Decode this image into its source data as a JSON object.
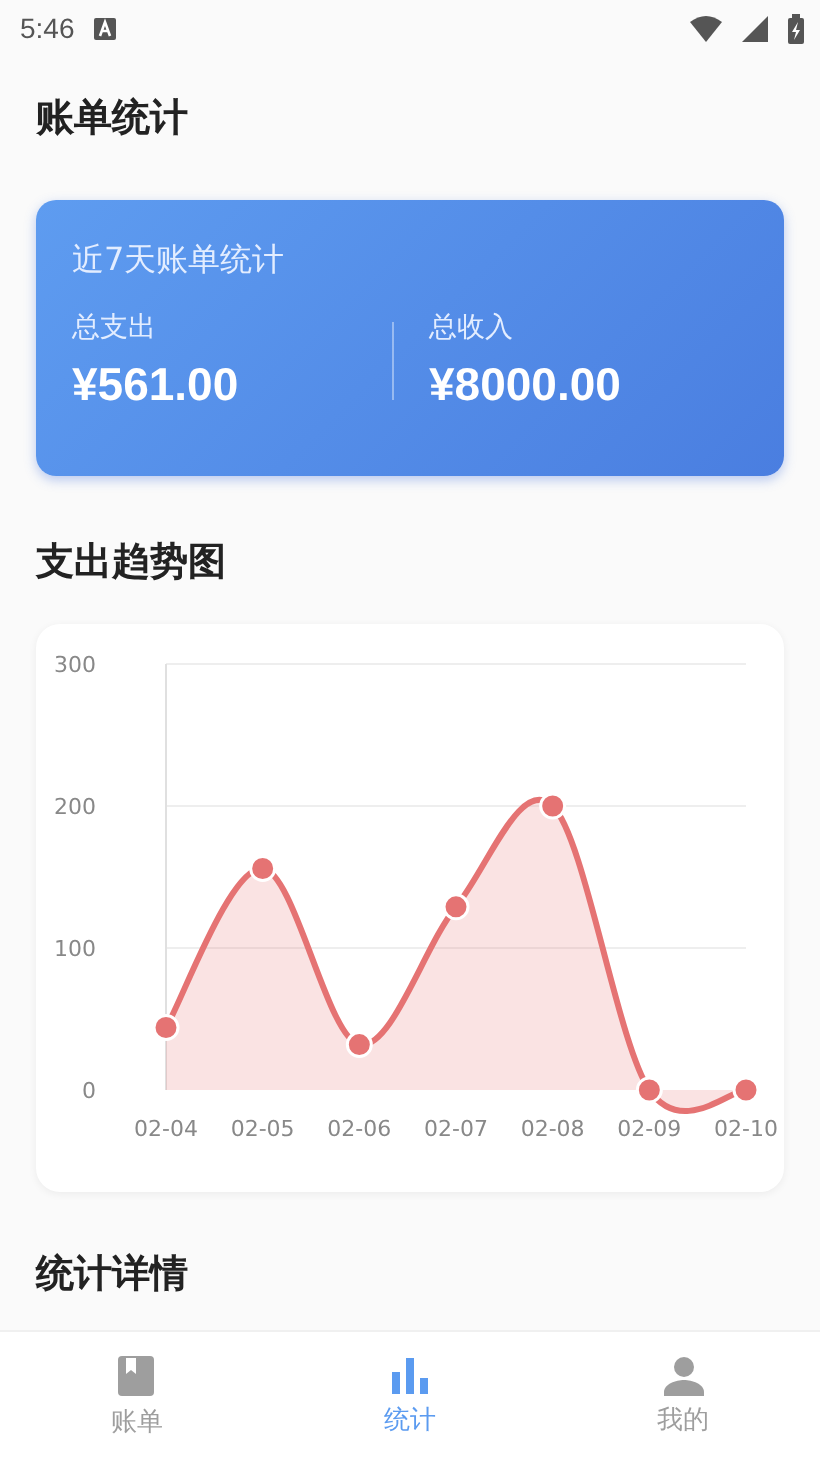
{
  "status_bar": {
    "time": "5:46"
  },
  "title": "账单统计",
  "summary": {
    "title": "近7天账单统计",
    "items": [
      {
        "label": "总支出",
        "value": "¥561.00"
      },
      {
        "label": "总收入",
        "value": "¥8000.00"
      }
    ]
  },
  "trend": {
    "title": "支出趋势图",
    "chart_data": {
      "type": "area",
      "categories": [
        "02-04",
        "02-05",
        "02-06",
        "02-07",
        "02-08",
        "02-09",
        "02-10"
      ],
      "series": [
        {
          "color": "#e57373",
          "values": [
            44,
            156,
            32,
            129,
            200,
            0,
            0
          ]
        }
      ],
      "ylim": [
        0,
        300
      ],
      "yticks": [
        0,
        100,
        200,
        300
      ]
    }
  },
  "details": {
    "title": "统计详情"
  },
  "nav": [
    {
      "label": "账单",
      "kind": "book",
      "selected": false
    },
    {
      "label": "统计",
      "kind": "chart",
      "selected": true
    },
    {
      "label": "我的",
      "kind": "person",
      "selected": false
    }
  ]
}
